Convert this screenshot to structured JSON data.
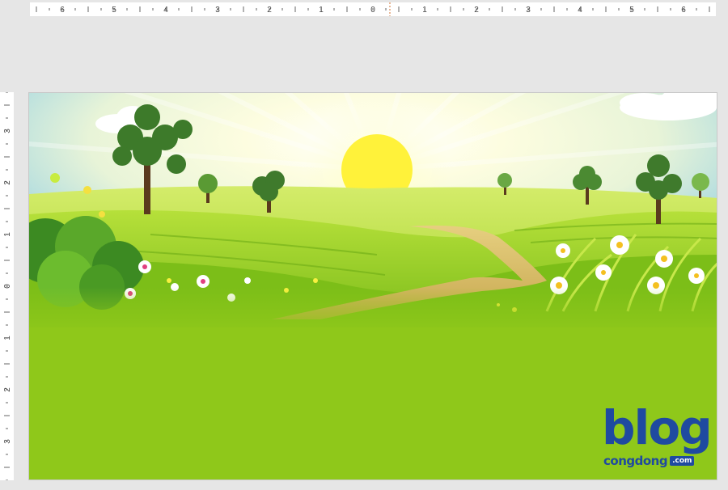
{
  "ruler": {
    "horizontal_labels": [
      "6",
      "5",
      "4",
      "3",
      "2",
      "1",
      "0",
      "1",
      "2",
      "3",
      "4",
      "5",
      "6"
    ],
    "vertical_labels": [
      "3",
      "2",
      "1",
      "0",
      "1",
      "2",
      "3"
    ]
  },
  "slide": {
    "picture_subject": "cartoon sunny meadow landscape",
    "colors": {
      "sky": "#7fc6e8",
      "sun": "#fff23a",
      "grass": "#8fc81a",
      "path": "#d8c070"
    }
  },
  "watermark": {
    "brand": "blog",
    "subtext": "congdong",
    "tld": ".com"
  }
}
